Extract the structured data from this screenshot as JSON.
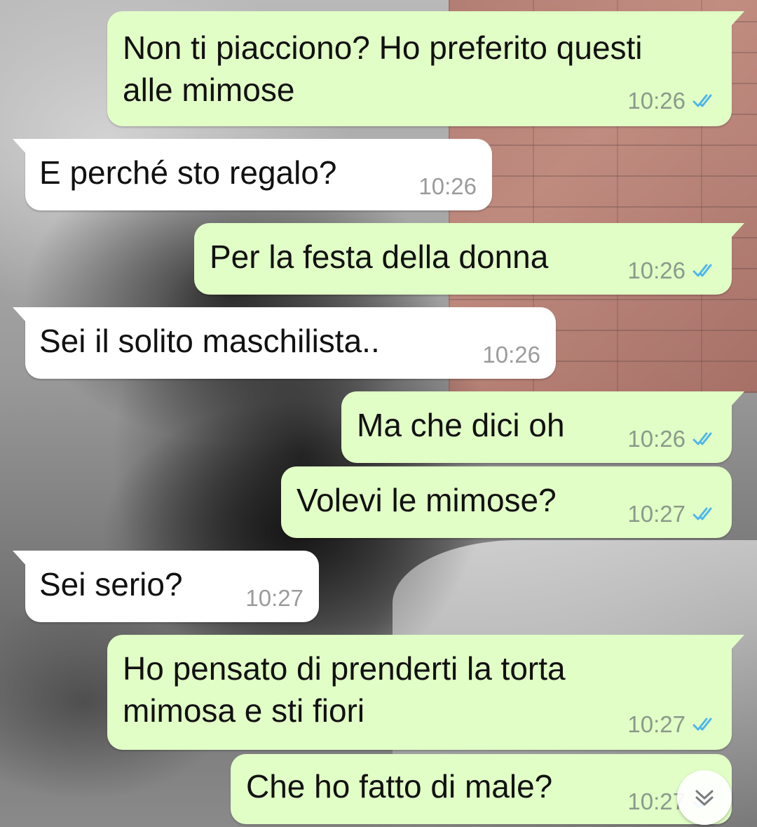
{
  "messages": [
    {
      "id": "m1",
      "direction": "out",
      "text": "Non ti piacciono? Ho preferito questi\nalle mimose",
      "time": "10:26",
      "status": "read"
    },
    {
      "id": "m2",
      "direction": "in",
      "text": "E perché sto regalo?",
      "time": "10:26"
    },
    {
      "id": "m3",
      "direction": "out",
      "text": "Per la festa della donna",
      "time": "10:26",
      "status": "read"
    },
    {
      "id": "m4",
      "direction": "in",
      "text": "Sei il solito maschilista..",
      "time": "10:26"
    },
    {
      "id": "m5",
      "direction": "out",
      "text": "Ma che dici oh",
      "time": "10:26",
      "status": "read"
    },
    {
      "id": "m6",
      "direction": "out",
      "text": "Volevi le mimose?",
      "time": "10:27",
      "status": "read"
    },
    {
      "id": "m7",
      "direction": "in",
      "text": "Sei serio?",
      "time": "10:27"
    },
    {
      "id": "m8",
      "direction": "out",
      "text": "Ho pensato di prenderti la torta\nmimosa e sti fiori",
      "time": "10:27",
      "status": "read"
    },
    {
      "id": "m9",
      "direction": "out",
      "text": "Che ho fatto di male?",
      "time": "10:27",
      "status": "read"
    }
  ],
  "colors": {
    "outgoing_bubble": "#e1fec6",
    "incoming_bubble": "#ffffff",
    "read_tick": "#4fb6ec"
  },
  "icons": {
    "read_status": "double-check-icon",
    "scroll_down": "chevron-down-icon"
  }
}
